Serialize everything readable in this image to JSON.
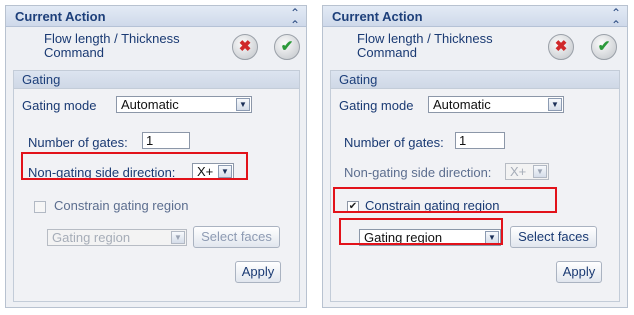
{
  "panels": [
    {
      "title": "Current Action",
      "collapse_icon": "double-chevron-up",
      "command": "Flow length / Thickness Command",
      "section_title": "Gating",
      "gating_mode_label": "Gating mode",
      "gating_mode_value": "Automatic",
      "num_gates_label": "Number of gates:",
      "num_gates_value": "1",
      "side_dir_label": "Non-gating side direction:",
      "side_dir_value": "X+",
      "side_dir_enabled": true,
      "constrain_label": "Constrain gating region",
      "constrain_checked": false,
      "region_value": "Gating region",
      "region_enabled": false,
      "select_faces_label": "Select faces",
      "apply_label": "Apply"
    },
    {
      "title": "Current Action",
      "collapse_icon": "double-chevron-up",
      "command": "Flow length / Thickness Command",
      "section_title": "Gating",
      "gating_mode_label": "Gating mode",
      "gating_mode_value": "Automatic",
      "num_gates_label": "Number of gates:",
      "num_gates_value": "1",
      "side_dir_label": "Non-gating side direction:",
      "side_dir_value": "X+",
      "side_dir_enabled": false,
      "constrain_label": "Constrain gating region",
      "constrain_checked": true,
      "region_value": "Gating region",
      "region_enabled": true,
      "select_faces_label": "Select faces",
      "apply_label": "Apply"
    }
  ],
  "icons": {
    "cancel": "close-x",
    "ok": "checkmark",
    "highlight_color": "#e2121a"
  }
}
